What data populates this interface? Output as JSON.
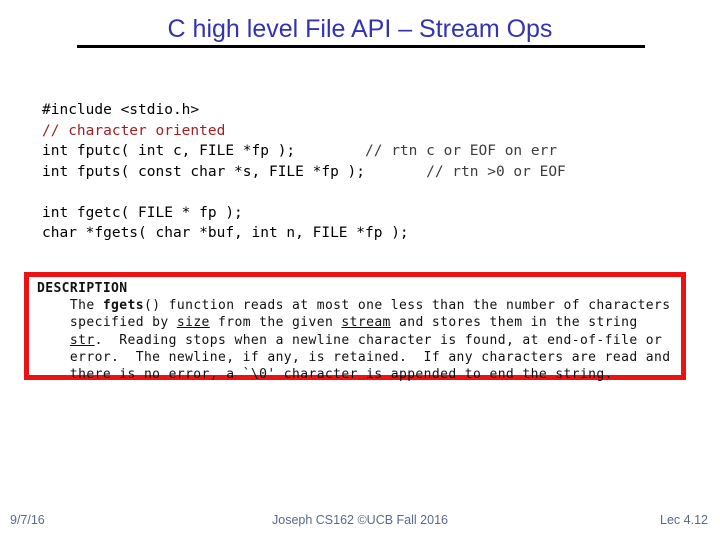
{
  "slide": {
    "title": "C high level File API – Stream Ops",
    "title_color": "#3333b0",
    "rule_color": "#000000",
    "background": "#ffffff"
  },
  "code": {
    "font": "monospace",
    "comment_color": "#a31f1f",
    "trailing_comment_color": "#3d3d3d",
    "text_color": "#000000",
    "lines": [
      {
        "text": "#include <stdio.h>",
        "style": "plain"
      },
      {
        "text": "// character oriented",
        "style": "comment"
      },
      {
        "main": "int fputc( int c, FILE *fp );",
        "gap": "        ",
        "comment": "// rtn c or EOF on err",
        "style": "code-with-comment"
      },
      {
        "main": "int fputs( const char *s, FILE *fp );",
        "gap": "       ",
        "comment": "// rtn >0 or EOF",
        "style": "code-with-comment"
      },
      {
        "text": "",
        "style": "blank"
      },
      {
        "text": "int fgetc( FILE * fp );",
        "style": "plain"
      },
      {
        "text": "char *fgets( char *buf, int n, FILE *fp );",
        "style": "plain"
      }
    ]
  },
  "manpage": {
    "border_color": "#ee1111",
    "heading": "DESCRIPTION",
    "lines": [
      [
        {
          "t": "    The ",
          "b": false,
          "u": false
        },
        {
          "t": "fgets",
          "b": true,
          "u": false
        },
        {
          "t": "() function reads at most one less than the number of characters",
          "b": false,
          "u": false
        }
      ],
      [
        {
          "t": "    specified by ",
          "b": false,
          "u": false
        },
        {
          "t": "size",
          "b": false,
          "u": true
        },
        {
          "t": " from the given ",
          "b": false,
          "u": false
        },
        {
          "t": "stream",
          "b": false,
          "u": true
        },
        {
          "t": " and stores them in the string",
          "b": false,
          "u": false
        }
      ],
      [
        {
          "t": "    ",
          "b": false,
          "u": false
        },
        {
          "t": "str",
          "b": false,
          "u": true
        },
        {
          "t": ".  Reading stops when a newline character is found, at end-of-file or",
          "b": false,
          "u": false
        }
      ],
      [
        {
          "t": "    error.  The newline, if any, is retained.  If any characters are read and",
          "b": false,
          "u": false
        }
      ],
      [
        {
          "t": "    there is no error, a `\\0' character is appended to end the string.",
          "b": false,
          "u": false
        }
      ]
    ]
  },
  "footer": {
    "date": "9/7/16",
    "center": "Joseph CS162 ©UCB Fall 2016",
    "lecture": "Lec 4.12",
    "color": "#5a6a86"
  }
}
